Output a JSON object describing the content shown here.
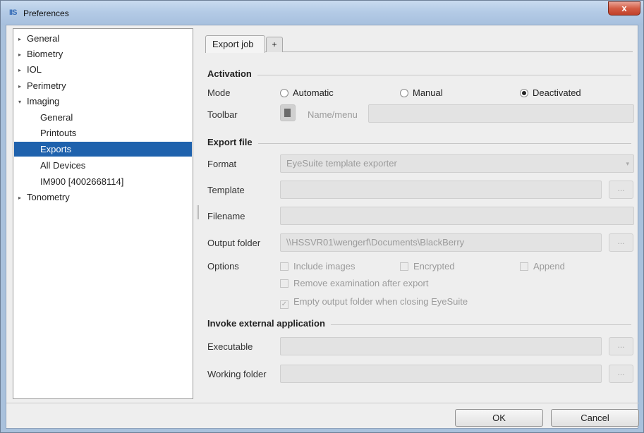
{
  "window": {
    "icon": "IIS",
    "title": "Preferences",
    "close_glyph": "x"
  },
  "tree": {
    "items": [
      {
        "label": "General",
        "expandable": true
      },
      {
        "label": "Biometry",
        "expandable": true
      },
      {
        "label": "IOL",
        "expandable": true
      },
      {
        "label": "Perimetry",
        "expandable": true
      },
      {
        "label": "Imaging",
        "expanded": true
      },
      {
        "label": "General",
        "child": true
      },
      {
        "label": "Printouts",
        "child": true
      },
      {
        "label": "Exports",
        "child": true,
        "selected": true
      },
      {
        "label": "All Devices",
        "child": true
      },
      {
        "label": "IM900 [4002668114]",
        "child": true
      },
      {
        "label": "Tonometry",
        "expandable": true
      }
    ],
    "collapsed_arrow": "▸",
    "expanded_arrow": "▾"
  },
  "tabs": {
    "active": "Export job",
    "add": "+"
  },
  "activation": {
    "heading": "Activation",
    "mode_label": "Mode",
    "modes": [
      "Automatic",
      "Manual",
      "Deactivated"
    ],
    "selected_mode": "Deactivated",
    "toolbar_label": "Toolbar",
    "toolbar_placeholder": "Name/menu",
    "toolbar_icon": "toolbar-book-icon"
  },
  "export_file": {
    "heading": "Export file",
    "format_label": "Format",
    "format_value": "EyeSuite template exporter",
    "template_label": "Template",
    "template_value": "",
    "filename_label": "Filename",
    "filename_value": "",
    "output_label": "Output folder",
    "output_value": "\\\\HSSVR01\\wengerf\\Documents\\BlackBerry",
    "browse_label": "...",
    "options_label": "Options",
    "options": [
      {
        "label": "Include images",
        "checked": false
      },
      {
        "label": "Encrypted",
        "checked": false
      },
      {
        "label": "Append",
        "checked": false
      },
      {
        "label": "Remove examination after export",
        "checked": false
      },
      {
        "label": "Empty output folder when closing EyeSuite",
        "checked": true
      }
    ]
  },
  "external": {
    "heading": "Invoke external application",
    "executable_label": "Executable",
    "executable_value": "",
    "working_label": "Working folder",
    "working_value": ""
  },
  "footer": {
    "ok": "OK",
    "cancel": "Cancel"
  },
  "colors": {
    "selection": "#1f62ad",
    "title_bar": "#b4cbe6",
    "close": "#c0402a"
  }
}
